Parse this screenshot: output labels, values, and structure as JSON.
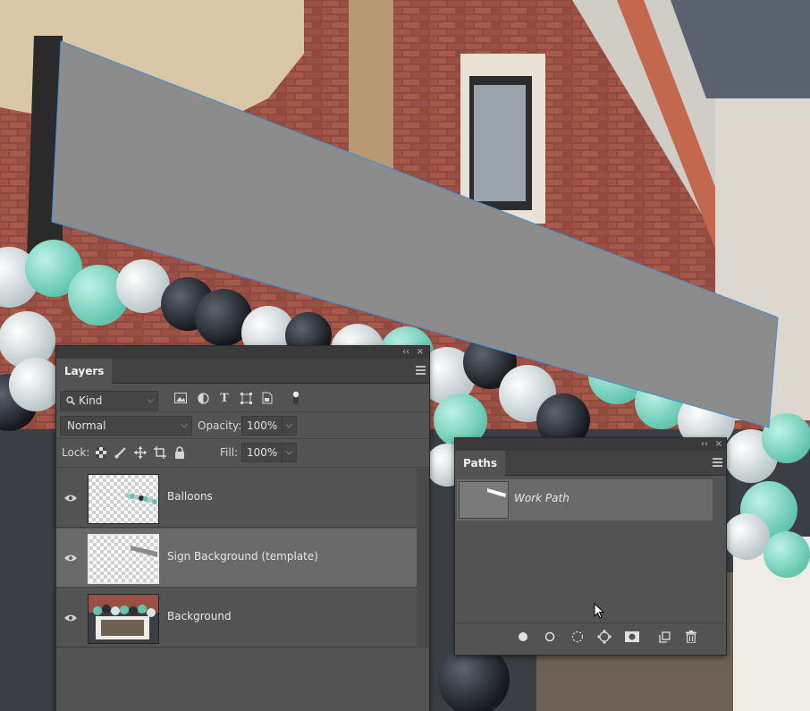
{
  "canvas": {
    "sign_fill": "#8c8c8c",
    "path_color": "#3d8fd6"
  },
  "layers_panel": {
    "collapse_label": "‹‹",
    "close_label": "×",
    "tab_label": "Layers",
    "filter": {
      "value": "Kind"
    },
    "blend_mode": "Normal",
    "opacity_label": "Opacity:",
    "opacity_value": "100%",
    "lock_label": "Lock:",
    "fill_label": "Fill:",
    "fill_value": "100%",
    "filter_icons": [
      "image-filter-icon",
      "adjustment-filter-icon",
      "type-filter-icon",
      "shape-filter-icon",
      "smart-object-filter-icon",
      "filter-toggle-icon"
    ],
    "lock_icons": [
      "lock-transparent-pixels-icon",
      "lock-image-pixels-icon",
      "lock-position-icon",
      "lock-artboard-icon",
      "lock-all-icon"
    ],
    "layers": [
      {
        "name": "Balloons",
        "visible": true,
        "selected": false
      },
      {
        "name": "Sign Background (template)",
        "visible": true,
        "selected": true
      },
      {
        "name": "Background",
        "visible": true,
        "selected": false
      }
    ]
  },
  "paths_panel": {
    "collapse_label": "‹‹",
    "close_label": "×",
    "tab_label": "Paths",
    "paths": [
      {
        "name": "Work Path"
      }
    ],
    "footer_icons": [
      "fill-path-icon",
      "stroke-path-icon",
      "load-as-selection-icon",
      "make-work-path-icon",
      "add-mask-icon",
      "new-path-icon",
      "delete-path-icon"
    ]
  },
  "colors": {
    "panel_bg": "#535353",
    "selected_row": "#6a6a6a"
  }
}
